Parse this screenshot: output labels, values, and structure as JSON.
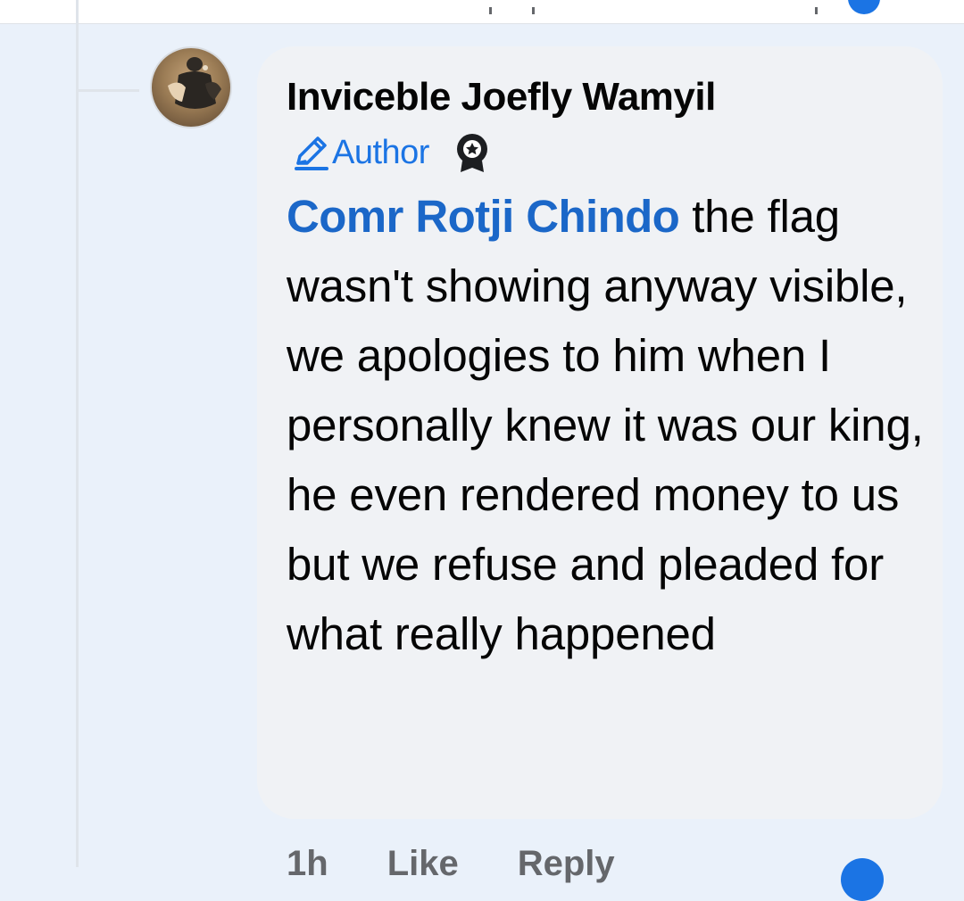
{
  "comment": {
    "author_name": "Inviceble Joefly Wamyil",
    "author_badge": "Author",
    "mention": "Comr Rotji Chindo",
    "text": " the flag wasn't showing anyway visible, we apologies to him when I personally knew it was our king, he even rendered money to us but we refuse and pleaded for what really happened"
  },
  "actions": {
    "time": "1h",
    "like": "Like",
    "reply": "Reply"
  },
  "icons": {
    "badge_pencil": "pencil-icon",
    "award": "award-icon"
  },
  "colors": {
    "accent": "#1b74e4",
    "mention": "#1b67c8",
    "bubble": "#f0f2f5",
    "page_background": "#eaf1fa"
  }
}
